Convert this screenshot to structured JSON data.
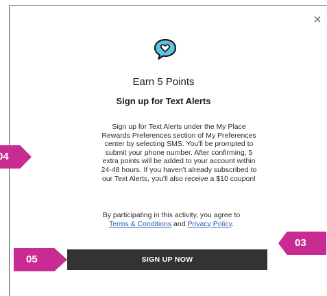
{
  "modal": {
    "close_label": "×",
    "icon": "heart-speech-bubble-icon",
    "headline": "Earn 5 Points",
    "subhead": "Sign up for Text Alerts",
    "body_lines": [
      "Sign up for Text Alerts under the My Place",
      "Rewards Preferences section of My Preferences",
      "center by selecting SMS. You'll be prompted to",
      "submit your phone number. After confirming, 5",
      "extra points will be added to your account within",
      "24-48 hours. If you haven't already subscribed to",
      "our Text Alerts, you'll also receive a $10 coupon!"
    ],
    "consent": {
      "line1": "By participating in this activity, you agree to",
      "terms_link": "Terms & Conditions",
      "and_text": " and ",
      "privacy_link": "Privacy Policy",
      "period": "."
    },
    "signup_label": "SIGN UP NOW"
  },
  "callouts": {
    "badge_03": "03",
    "badge_04": "04",
    "badge_05": "05",
    "color": "#c82b92"
  },
  "colors": {
    "button_bg": "#333333",
    "link": "#2a5db0",
    "icon_fill": "#5ec4e6"
  }
}
